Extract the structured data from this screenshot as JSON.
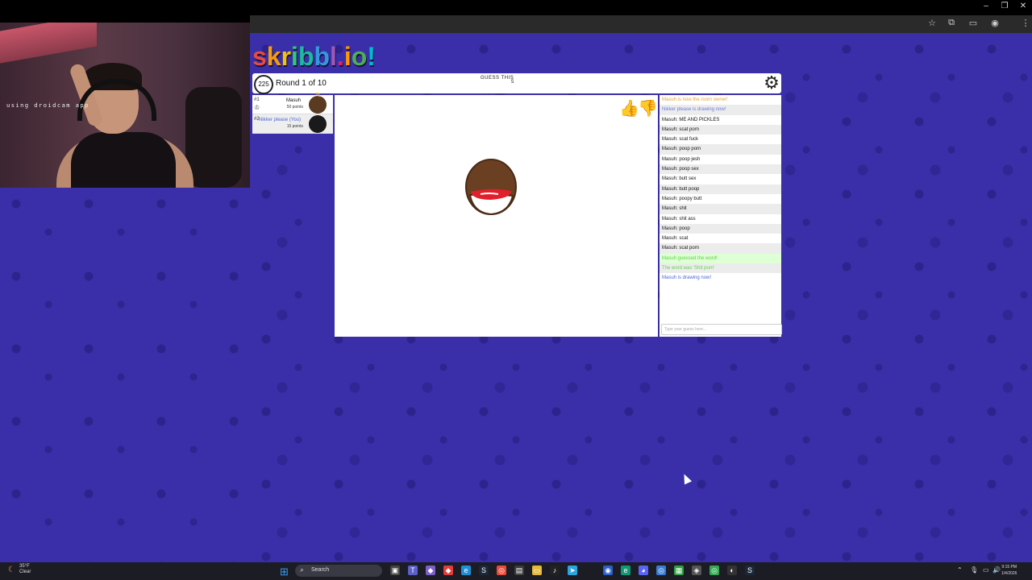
{
  "webcam": {
    "overlay_text": "using droidcam app"
  },
  "browser": {
    "window_controls": {
      "minimize": "–",
      "restore": "❐",
      "close": "✕"
    },
    "toolbar_icons": [
      "star-icon",
      "extensions-icon",
      "cast-icon",
      "menu-icon"
    ]
  },
  "game": {
    "logo_letters": [
      {
        "ch": "s",
        "color": "#e74c3c"
      },
      {
        "ch": "k",
        "color": "#f39c12"
      },
      {
        "ch": "r",
        "color": "#f1c40f"
      },
      {
        "ch": "i",
        "color": "#2ecc71"
      },
      {
        "ch": "b",
        "color": "#1abc9c"
      },
      {
        "ch": "b",
        "color": "#3498db"
      },
      {
        "ch": "l",
        "color": "#9b59b6"
      },
      {
        "ch": ".",
        "color": "#e91e63"
      },
      {
        "ch": "i",
        "color": "#ff9800"
      },
      {
        "ch": "o",
        "color": "#4caf50"
      },
      {
        "ch": "!",
        "color": "#00bcd4"
      }
    ],
    "timer": "225",
    "round_text": "Round 1 of 10",
    "guess_label": "GUESS THIS",
    "word_length": "5",
    "word_blanks": "_ _ _ _ _",
    "players": [
      {
        "rank": "#1",
        "name": "Masuh",
        "points": "50 points",
        "drawing": true
      },
      {
        "rank": "#2",
        "name": "Nikker please (You)",
        "points": "15 points",
        "drawing": false
      }
    ],
    "chat": [
      {
        "text": "Masuh is now the room owner!",
        "style": "orange"
      },
      {
        "text": "Nikker please is drawing now!",
        "style": "purple"
      },
      {
        "text": "Masuh: ME AND PICKLES",
        "style": ""
      },
      {
        "text": "Masuh: scat porn",
        "style": ""
      },
      {
        "text": "Masuh: scat fuck",
        "style": ""
      },
      {
        "text": "Masuh: poop porn",
        "style": ""
      },
      {
        "text": "Masuh: poop jesh",
        "style": ""
      },
      {
        "text": "Masuh: poop sex",
        "style": ""
      },
      {
        "text": "Masuh: butt sex",
        "style": ""
      },
      {
        "text": "Masuh: butt poop",
        "style": ""
      },
      {
        "text": "Masuh: poopy butt",
        "style": ""
      },
      {
        "text": "Masuh: shit",
        "style": ""
      },
      {
        "text": "Masuh: shit ass",
        "style": ""
      },
      {
        "text": "Masuh: poop",
        "style": ""
      },
      {
        "text": "Masuh: scat",
        "style": ""
      },
      {
        "text": "Masuh: scat porn",
        "style": ""
      },
      {
        "text": "Masuh guessed the word!",
        "style": "green greenbg"
      },
      {
        "text": "The word was 'Shit porn'",
        "style": "green"
      },
      {
        "text": "Masuh is drawing now!",
        "style": "blue"
      }
    ],
    "chat_placeholder": "Type your guess here..."
  },
  "taskbar": {
    "weather_temp": "35°F",
    "weather_desc": "Clear",
    "search_label": "Search",
    "time": "9:15 PM",
    "date": "1/4/2026"
  }
}
